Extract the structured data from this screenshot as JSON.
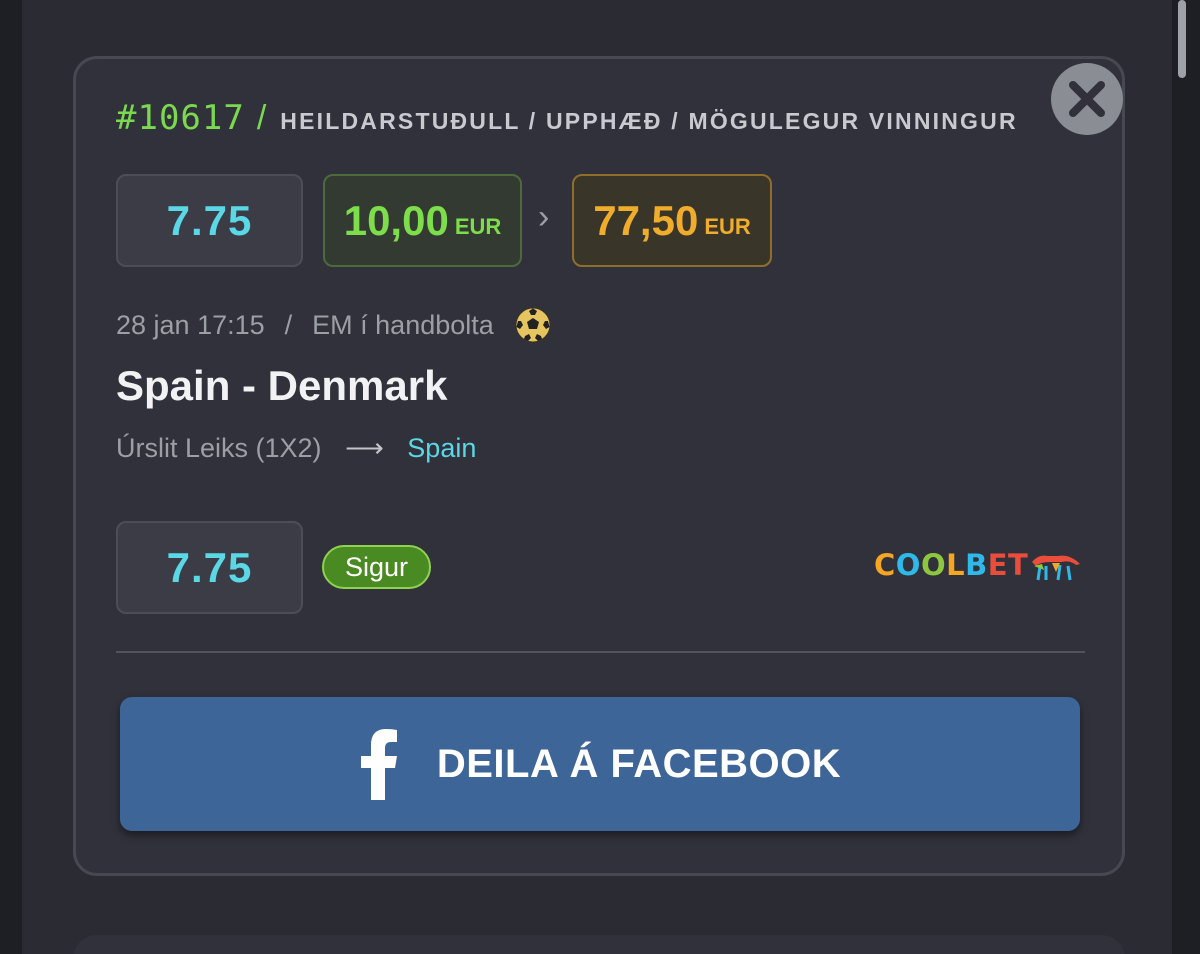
{
  "bet": {
    "id": "#10617",
    "header_separator": "/",
    "header_labels": "HEILDARSTUÐULL / UPPHÆÐ / MÖGULEGUR VINNINGUR"
  },
  "summary": {
    "total_odds": "7.75",
    "stake_amount": "10,00",
    "stake_currency": "EUR",
    "arrow": "›",
    "potential_win_amount": "77,50",
    "potential_win_currency": "EUR"
  },
  "event": {
    "datetime": "28 jan 17:15",
    "separator": "/",
    "league": "EM í handbolta",
    "sport_icon": "soccer-ball-icon",
    "match": "Spain - Denmark",
    "market": "Úrslit Leiks (1X2)",
    "market_arrow": "⟶",
    "selection": "Spain"
  },
  "selection_row": {
    "odds": "7.75",
    "status": "Sigur"
  },
  "brand": {
    "name": "COOLBET",
    "letters": [
      {
        "char": "C",
        "color": "#f6a623"
      },
      {
        "char": "O",
        "color": "#2fb9e8"
      },
      {
        "char": "O",
        "color": "#8dc63f"
      },
      {
        "char": "L",
        "color": "#f6a623"
      },
      {
        "char": "B",
        "color": "#2fb9e8"
      },
      {
        "char": "E",
        "color": "#e94e3c"
      },
      {
        "char": "T",
        "color": "#e94e3c"
      }
    ]
  },
  "share": {
    "label": "DEILA Á FACEBOOK",
    "icon": "facebook-icon"
  },
  "colors": {
    "accent_green": "#7ad94f",
    "odds_cyan": "#5ad8e6",
    "win_orange": "#f0ad2c",
    "facebook_blue": "#3d6597",
    "status_green": "#4a8a22"
  }
}
